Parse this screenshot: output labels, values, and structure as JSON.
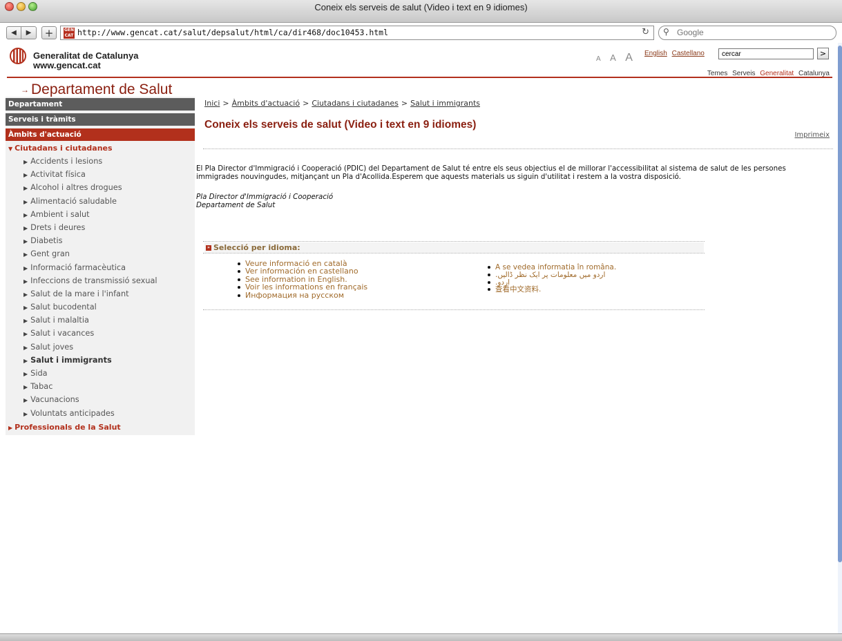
{
  "window": {
    "title": "Coneix els serveis de salut (Video i text en 9 idiomes)"
  },
  "toolbar": {
    "back": "◀",
    "forward": "▶",
    "add": "+",
    "url": "http://www.gencat.cat/salut/depsalut/html/ca/dir468/doc10453.html",
    "reload": "↻",
    "search_placeholder": "Google"
  },
  "header": {
    "org_name": "Generalitat de Catalunya",
    "org_url": "www.gencat.cat",
    "font_sizes": [
      "A",
      "A",
      "A"
    ],
    "lang_links": [
      "English",
      "Castellano"
    ],
    "search_value": "cercar",
    "search_go": ">",
    "nav": [
      "Temes",
      "Serveis",
      "Generalitat",
      "Catalunya"
    ],
    "brand_color": "#b2301c"
  },
  "department_title": "Departament de Salut",
  "sidebar": {
    "top_items": [
      "Departament",
      "Serveis i tràmits",
      "Àmbits d'actuació"
    ],
    "section": "Ciutadans i ciutadanes",
    "items": [
      "Accidents i lesions",
      "Activitat física",
      "Alcohol i altres drogues",
      "Alimentació saludable",
      "Ambient i salut",
      "Drets i deures",
      "Diabetis",
      "Gent gran",
      "Informació farmacèutica",
      "Infeccions de transmissió sexual",
      "Salut de la mare i l'infant",
      "Salut bucodental",
      "Salut i malaltia",
      "Salut i vacances",
      "Salut joves",
      "Salut i immigrants",
      "Sida",
      "Tabac",
      "Vacunacions",
      "Voluntats anticipades"
    ],
    "professionals": "Professionals de la Salut"
  },
  "main": {
    "breadcrumb": [
      "Inici",
      "Àmbits d'actuació",
      "Ciutadans i ciutadanes",
      "Salut i immigrants"
    ],
    "breadcrumb_sep": ">",
    "title": "Coneix els serveis de salut (Video i text en 9 idiomes)",
    "print": "Imprimeix",
    "intro": "El Pla Director d'Immigració i Cooperació (PDIC) del Departament de Salut té entre els seus objectius el de millorar l'accessibilitat al sistema de salut de les persones immigrades nouvingudes, mitjançant un Pla d'Acollida.Esperem que aquests materials us siguin d'utilitat i restem a la vostra disposició.",
    "signature_1": "Pla Director d'Immigració i Cooperació",
    "signature_2": "Departament de Salut",
    "language_heading": "Selecció per idioma:",
    "languages_left": [
      "Veure informació en català",
      "Ver información en castellano",
      "See information in English.",
      "Voir les informations en français",
      "Информация на русском"
    ],
    "languages_right": [
      "A se vedea informatia în româna.",
      ".اردو میں معلومات پر ایک نظر ڈالیں",
      ".اردو",
      "查看中文资料."
    ]
  }
}
